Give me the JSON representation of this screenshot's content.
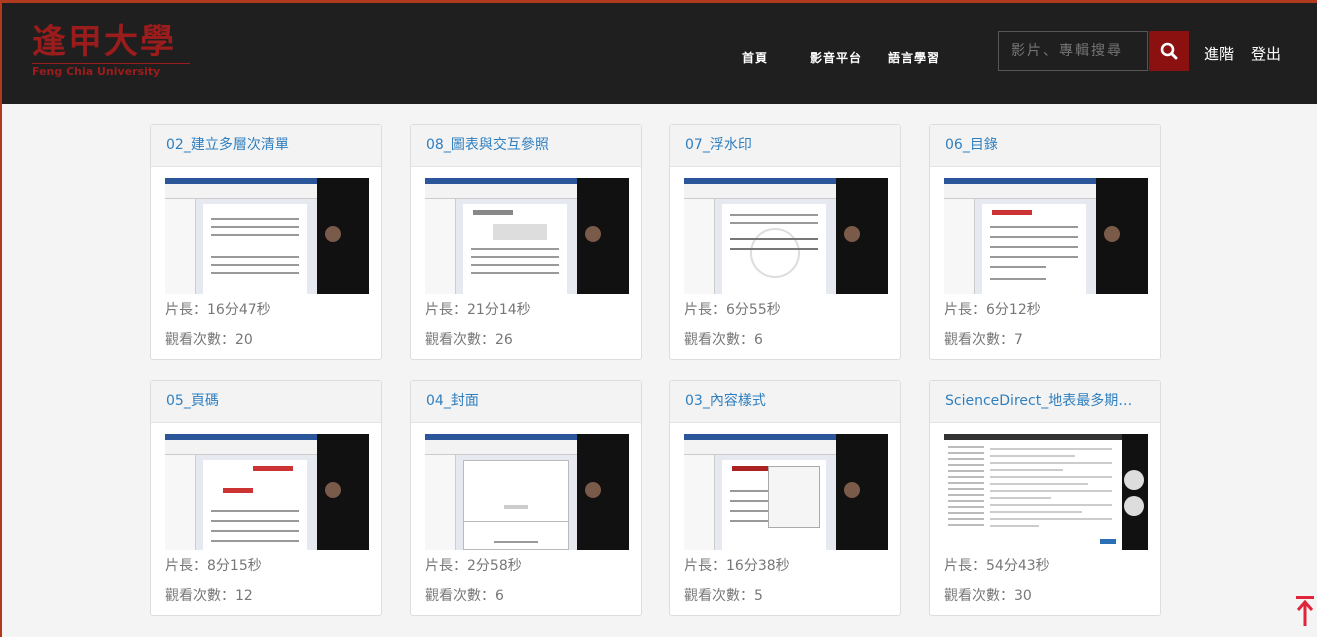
{
  "header": {
    "logo_cn": "逢甲大學",
    "logo_en": "Feng Chia University",
    "nav": [
      "首頁",
      "影音平台",
      "語言學習"
    ],
    "search_placeholder": "影片、專輯搜尋",
    "advanced": "進階",
    "logout": "登出"
  },
  "videos": [
    {
      "title": "02_建立多層次清單",
      "length": "片長：16分47秒",
      "views": "觀看次數：20"
    },
    {
      "title": "08_圖表與交互參照",
      "length": "片長：21分14秒",
      "views": "觀看次數：26"
    },
    {
      "title": "07_浮水印",
      "length": "片長：6分55秒",
      "views": "觀看次數：6"
    },
    {
      "title": "06_目錄",
      "length": "片長：6分12秒",
      "views": "觀看次數：7"
    },
    {
      "title": "05_頁碼",
      "length": "片長：8分15秒",
      "views": "觀看次數：12"
    },
    {
      "title": "04_封面",
      "length": "片長：2分58秒",
      "views": "觀看次數：6"
    },
    {
      "title": "03_內容樣式",
      "length": "片長：16分38秒",
      "views": "觀看次數：5"
    },
    {
      "title": "ScienceDirect_地表最多期刊...",
      "length": "片長：54分43秒",
      "views": "觀看次數：30"
    }
  ],
  "colors": {
    "brand": "#9b1c1c",
    "link": "#2f7fbf",
    "header_bg": "#1f1f1f"
  },
  "icons": {
    "search": "search-icon",
    "back_to_top": "arrow-up-icon"
  }
}
